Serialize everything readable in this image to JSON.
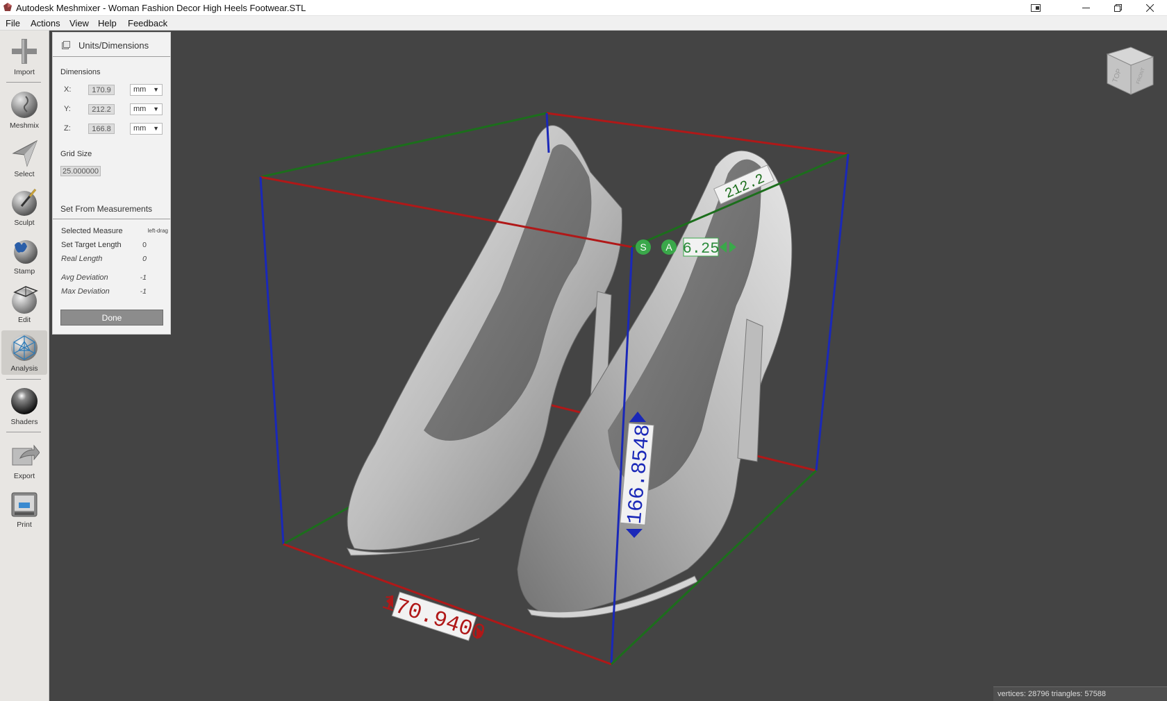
{
  "window": {
    "title": "Autodesk Meshmixer - Woman Fashion Decor High Heels Footwear.STL"
  },
  "menu": [
    "File",
    "Actions",
    "View",
    "Help",
    "Feedback"
  ],
  "tools": [
    {
      "label": "Import",
      "icon": "plus-icon"
    },
    {
      "label": "Meshmix",
      "icon": "meshmix-icon"
    },
    {
      "label": "Select",
      "icon": "cursor-icon"
    },
    {
      "label": "Sculpt",
      "icon": "brush-icon"
    },
    {
      "label": "Stamp",
      "icon": "stamp-icon"
    },
    {
      "label": "Edit",
      "icon": "edit-icon"
    },
    {
      "label": "Analysis",
      "icon": "analysis-icon"
    },
    {
      "label": "Shaders",
      "icon": "shader-sphere-icon"
    },
    {
      "label": "Export",
      "icon": "export-icon"
    },
    {
      "label": "Print",
      "icon": "printer-icon"
    }
  ],
  "panel": {
    "title": "Units/Dimensions",
    "dimensions_label": "Dimensions",
    "x": {
      "axis": "X:",
      "value": "170.9",
      "unit": "mm"
    },
    "y": {
      "axis": "Y:",
      "value": "212.2",
      "unit": "mm"
    },
    "z": {
      "axis": "Z:",
      "value": "166.8",
      "unit": "mm"
    },
    "grid_label": "Grid Size",
    "grid_value": "25.000000",
    "set_from_label": "Set From Measurements",
    "selected_measure": {
      "label": "Selected Measure",
      "value": "left-drag"
    },
    "target_length": {
      "label": "Set Target Length",
      "value": "0"
    },
    "real_length": {
      "label": "Real Length",
      "value": "0"
    },
    "avg_dev": {
      "label": "Avg Deviation",
      "value": "-1"
    },
    "max_dev": {
      "label": "Max Deviation",
      "value": "-1"
    },
    "done": "Done"
  },
  "viewport": {
    "dim_x_label": "170.9400",
    "dim_z_label": "166.8548",
    "dim_y_label": "212.2",
    "snap_s": "S",
    "snap_a": "A",
    "snap_value": "6.25",
    "viewcube_top": "TOP",
    "viewcube_side": "FRONT"
  },
  "status": "vertices: 28796 triangles: 57588",
  "colors": {
    "viewport_bg": "#444444",
    "axis_x": "#b01818",
    "axis_y": "#1c6e1c",
    "axis_z": "#1a28b8"
  }
}
